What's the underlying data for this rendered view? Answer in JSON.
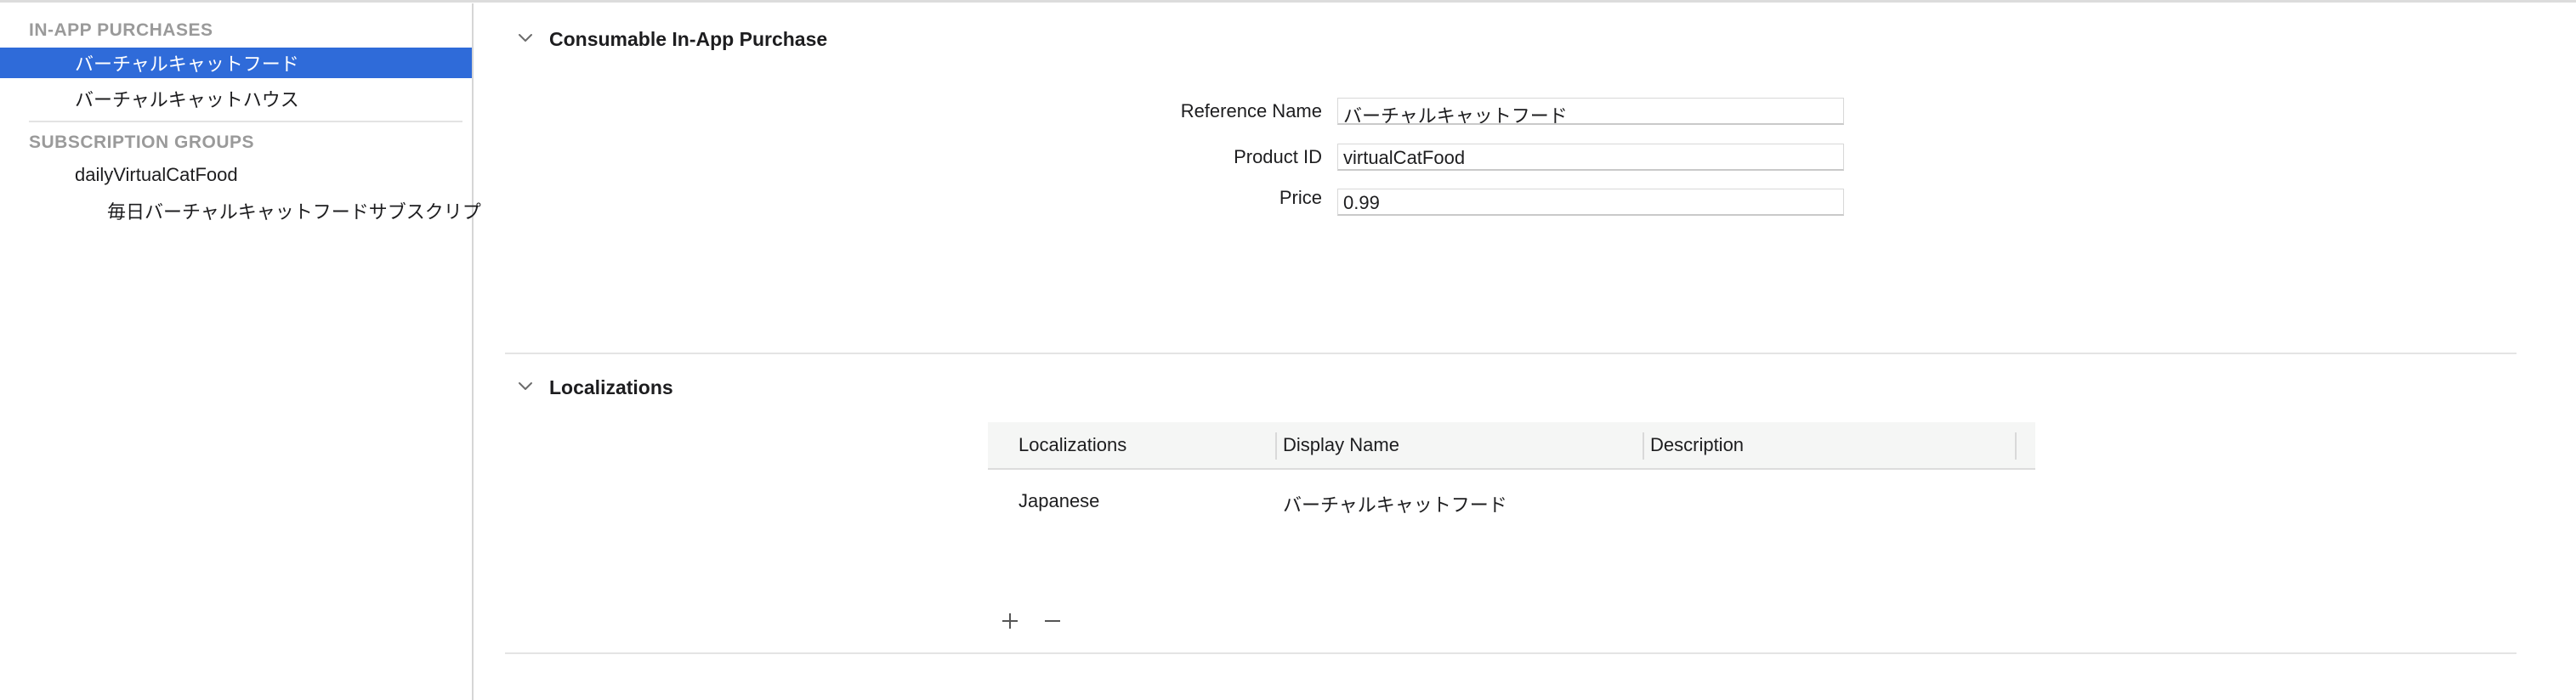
{
  "sidebar": {
    "in_app_header": "IN-APP PURCHASES",
    "in_app_items": [
      {
        "label": "バーチャルキャットフード",
        "selected": true
      },
      {
        "label": "バーチャルキャットハウス",
        "selected": false
      }
    ],
    "subscription_header": "SUBSCRIPTION GROUPS",
    "subscription_groups": [
      {
        "label": "dailyVirtualCatFood",
        "children": [
          {
            "label": "毎日バーチャルキャットフードサブスクリプ"
          }
        ]
      }
    ]
  },
  "purchase_panel": {
    "title": "Consumable In-App Purchase",
    "chevron_icon": "chevron-down-icon",
    "fields": {
      "reference_name": {
        "label": "Reference Name",
        "value": "バーチャルキャットフード"
      },
      "product_id": {
        "label": "Product ID",
        "value": "virtualCatFood"
      },
      "price": {
        "label": "Price",
        "value": "0.99"
      }
    }
  },
  "localizations_panel": {
    "title": "Localizations",
    "chevron_icon": "chevron-down-icon",
    "columns": [
      "Localizations",
      "Display Name",
      "Description"
    ],
    "rows": [
      {
        "localization": "Japanese",
        "display_name": "バーチャルキャットフード",
        "description": ""
      }
    ],
    "add_icon": "plus-icon",
    "remove_icon": "minus-icon"
  },
  "colors": {
    "selection": "#2f6bd9",
    "section_header": "#9a9a9a",
    "divider": "#e4e4e4"
  }
}
